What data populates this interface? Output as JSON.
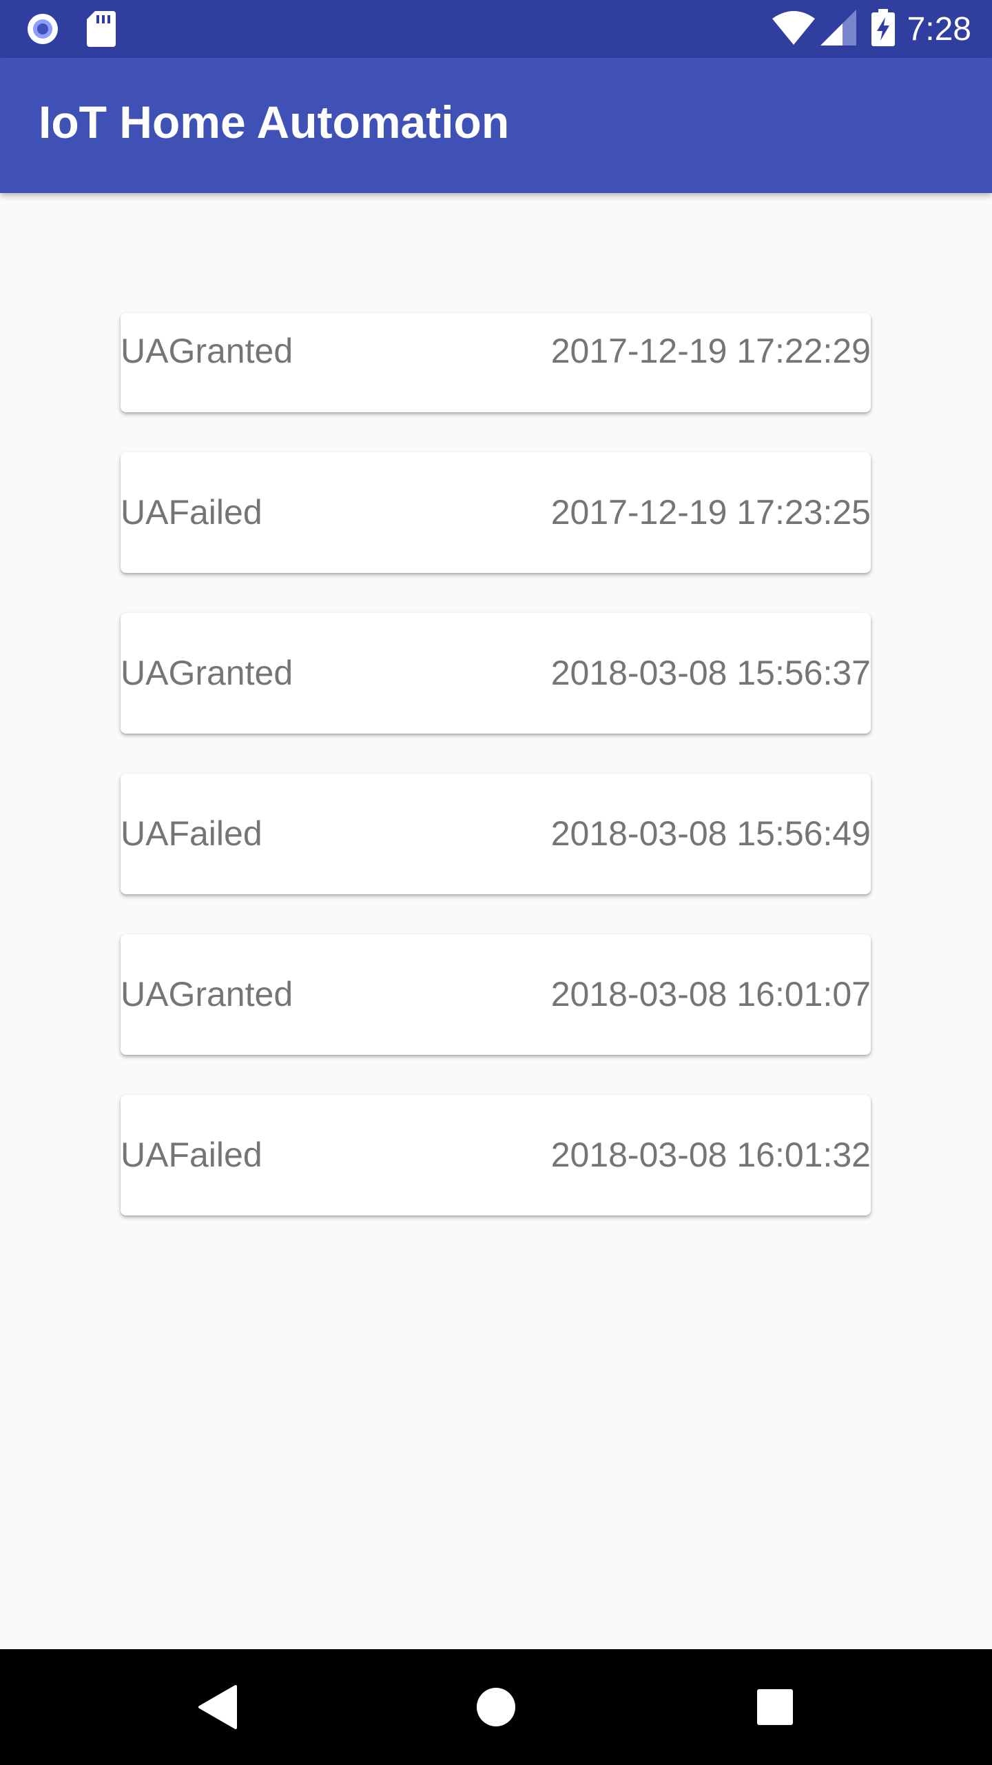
{
  "status_bar": {
    "time": "7:28",
    "icons": [
      "radio-icon",
      "sd-card-icon",
      "wifi-icon",
      "signal-icon",
      "battery-charging-icon"
    ]
  },
  "app_bar": {
    "title": "IoT Home Automation"
  },
  "entries": [
    {
      "status": "UAGranted",
      "timestamp": "2017-12-19 17:22:29"
    },
    {
      "status": "UAFailed",
      "timestamp": "2017-12-19 17:23:25"
    },
    {
      "status": "UAGranted",
      "timestamp": "2018-03-08 15:56:37"
    },
    {
      "status": "UAFailed",
      "timestamp": "2018-03-08 15:56:49"
    },
    {
      "status": "UAGranted",
      "timestamp": "2018-03-08 16:01:07"
    },
    {
      "status": "UAFailed",
      "timestamp": "2018-03-08 16:01:32"
    }
  ],
  "nav_bar": {
    "buttons": [
      "back-icon",
      "home-icon",
      "recents-icon"
    ]
  },
  "colors": {
    "status_bar": "#303f9f",
    "app_bar": "#3f51b5",
    "background": "#fafafa",
    "card_text": "#757575"
  }
}
